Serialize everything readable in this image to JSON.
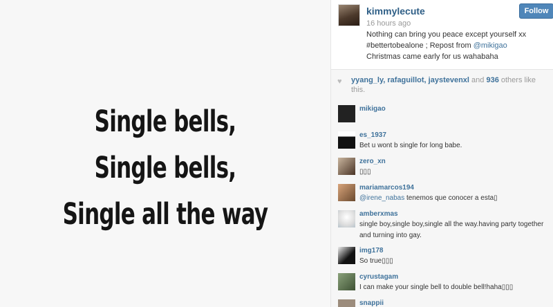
{
  "photo": {
    "lines": [
      "Single bells,",
      "Single bells,",
      "Single all the way"
    ]
  },
  "post": {
    "username": "kimmylecute",
    "time_ago": "16 hours ago",
    "caption_text": "Nothing can bring you peace except yourself xx #bettertobealone ; Repost from ",
    "caption_mention": "@mikigao",
    "caption_rest": " Christmas came early for us wahabaha",
    "follow_label": "Follow"
  },
  "likes": {
    "users": "yyang_ly, rafaguillot, jaystevenxl",
    "and_text": " and ",
    "count": "936",
    "others_text": " others like this."
  },
  "comments": [
    {
      "user": "mikigao",
      "mention": "",
      "text": ""
    },
    {
      "user": "es_1937",
      "mention": "",
      "text": "Bet u wont b single for long babe."
    },
    {
      "user": "zero_xn",
      "mention": "",
      "text": "▯▯▯"
    },
    {
      "user": "mariamarcos194",
      "mention": "@irene_nabas",
      "text": " tenemos que conocer a esta▯"
    },
    {
      "user": "amberxmas",
      "mention": "",
      "text": "single boy,single boy,single all the way.having party together and turning into gay."
    },
    {
      "user": "img178",
      "mention": "",
      "text": "So true▯▯▯"
    },
    {
      "user": "cyrustagam",
      "mention": "",
      "text": "I can make your single bell to double bell!haha▯▯▯"
    },
    {
      "user": "snappii",
      "mention": "",
      "text": ""
    }
  ],
  "colors": {
    "link": "#3f729b",
    "follow_button": "#4f86b9",
    "panel_bg": "#f6f6f6"
  }
}
